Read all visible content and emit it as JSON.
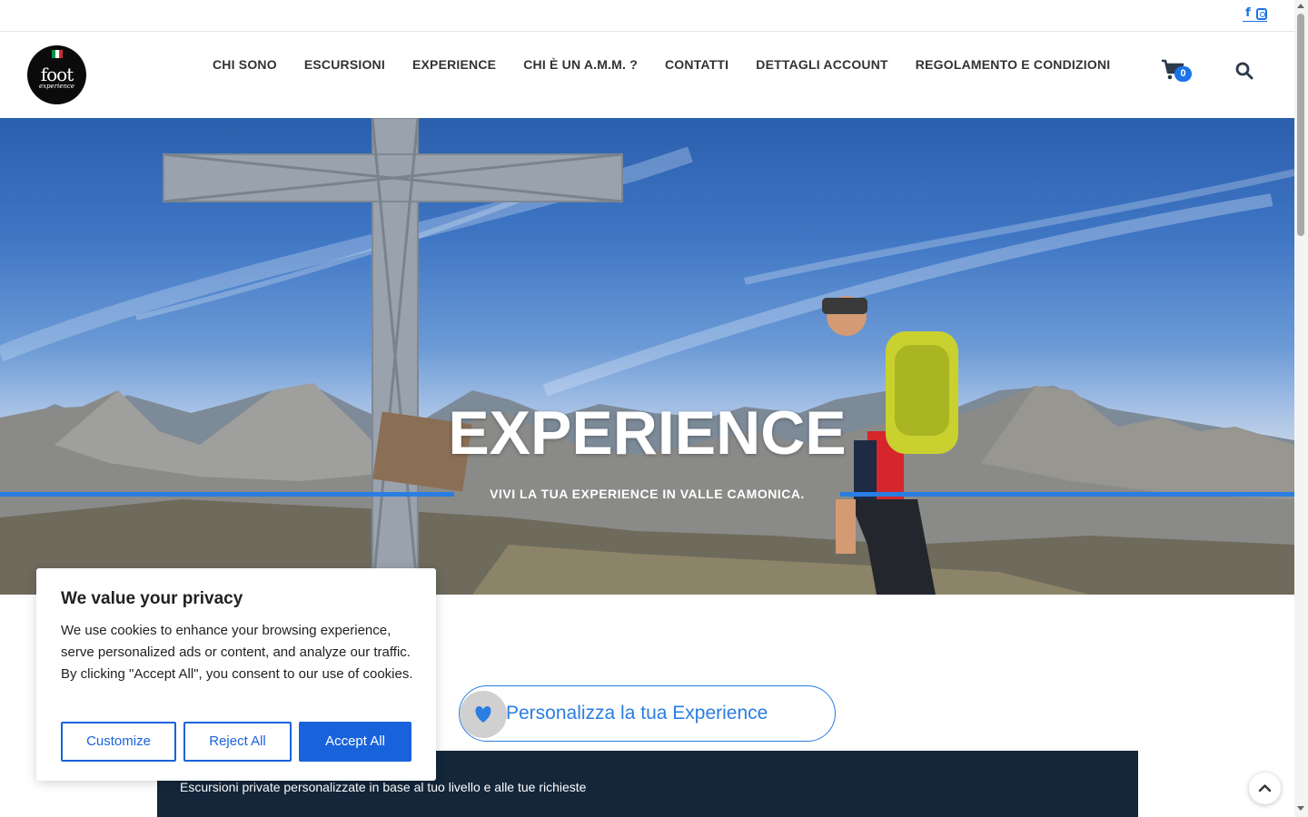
{
  "topbar": {
    "social": [
      {
        "name": "facebook-icon",
        "glyph": "f"
      },
      {
        "name": "instagram-icon",
        "glyph": ""
      }
    ]
  },
  "header": {
    "logo_text": "foot",
    "logo_sub": "experience",
    "nav": [
      "CHI SONO",
      "ESCURSIONI",
      "EXPERIENCE",
      "CHI È UN A.M.M. ?",
      "CONTATTI",
      "DETTAGLI ACCOUNT",
      "REGOLAMENTO E CONDIZIONI"
    ],
    "cart_count": "0"
  },
  "hero": {
    "title": "EXPERIENCE",
    "subtitle": "VIVI LA TUA EXPERIENCE IN VALLE CAMONICA."
  },
  "personalize": {
    "label": "Personalizza la tua Experience"
  },
  "info_strip": {
    "text": "Escursioni private personalizzate in base al tuo livello e alle tue richieste"
  },
  "cookie_banner": {
    "title": "We value your privacy",
    "body": "We use cookies to enhance your browsing experience, serve personalized ads or content, and analyze our traffic. By clicking \"Accept All\", you consent to our use of cookies.",
    "customize": "Customize",
    "reject": "Reject All",
    "accept": "Accept All"
  },
  "colors": {
    "accent": "#2a7de1",
    "cookie_blue": "#1863dc",
    "dark_strip": "#13263a"
  }
}
